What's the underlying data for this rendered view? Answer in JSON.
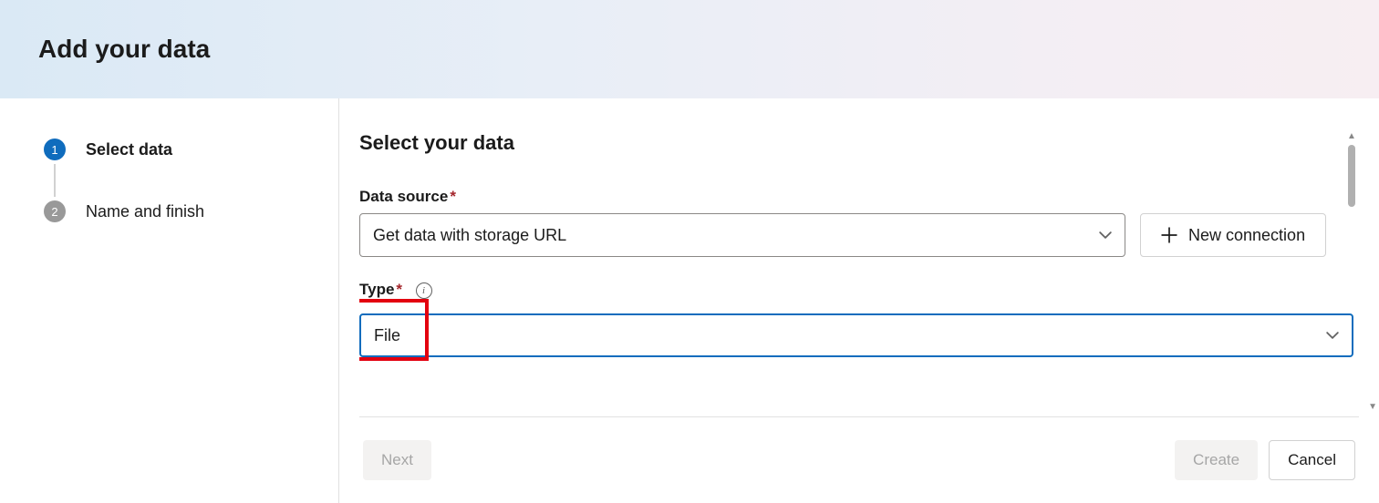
{
  "header": {
    "title": "Add your data"
  },
  "sidebar": {
    "steps": [
      {
        "number": "1",
        "label": "Select data",
        "active": true
      },
      {
        "number": "2",
        "label": "Name and finish",
        "active": false
      }
    ]
  },
  "main": {
    "section_title": "Select your data",
    "data_source": {
      "label": "Data source",
      "value": "Get data with storage URL"
    },
    "new_connection_label": "New connection",
    "type": {
      "label": "Type",
      "value": "File"
    }
  },
  "footer": {
    "next_label": "Next",
    "create_label": "Create",
    "cancel_label": "Cancel"
  }
}
